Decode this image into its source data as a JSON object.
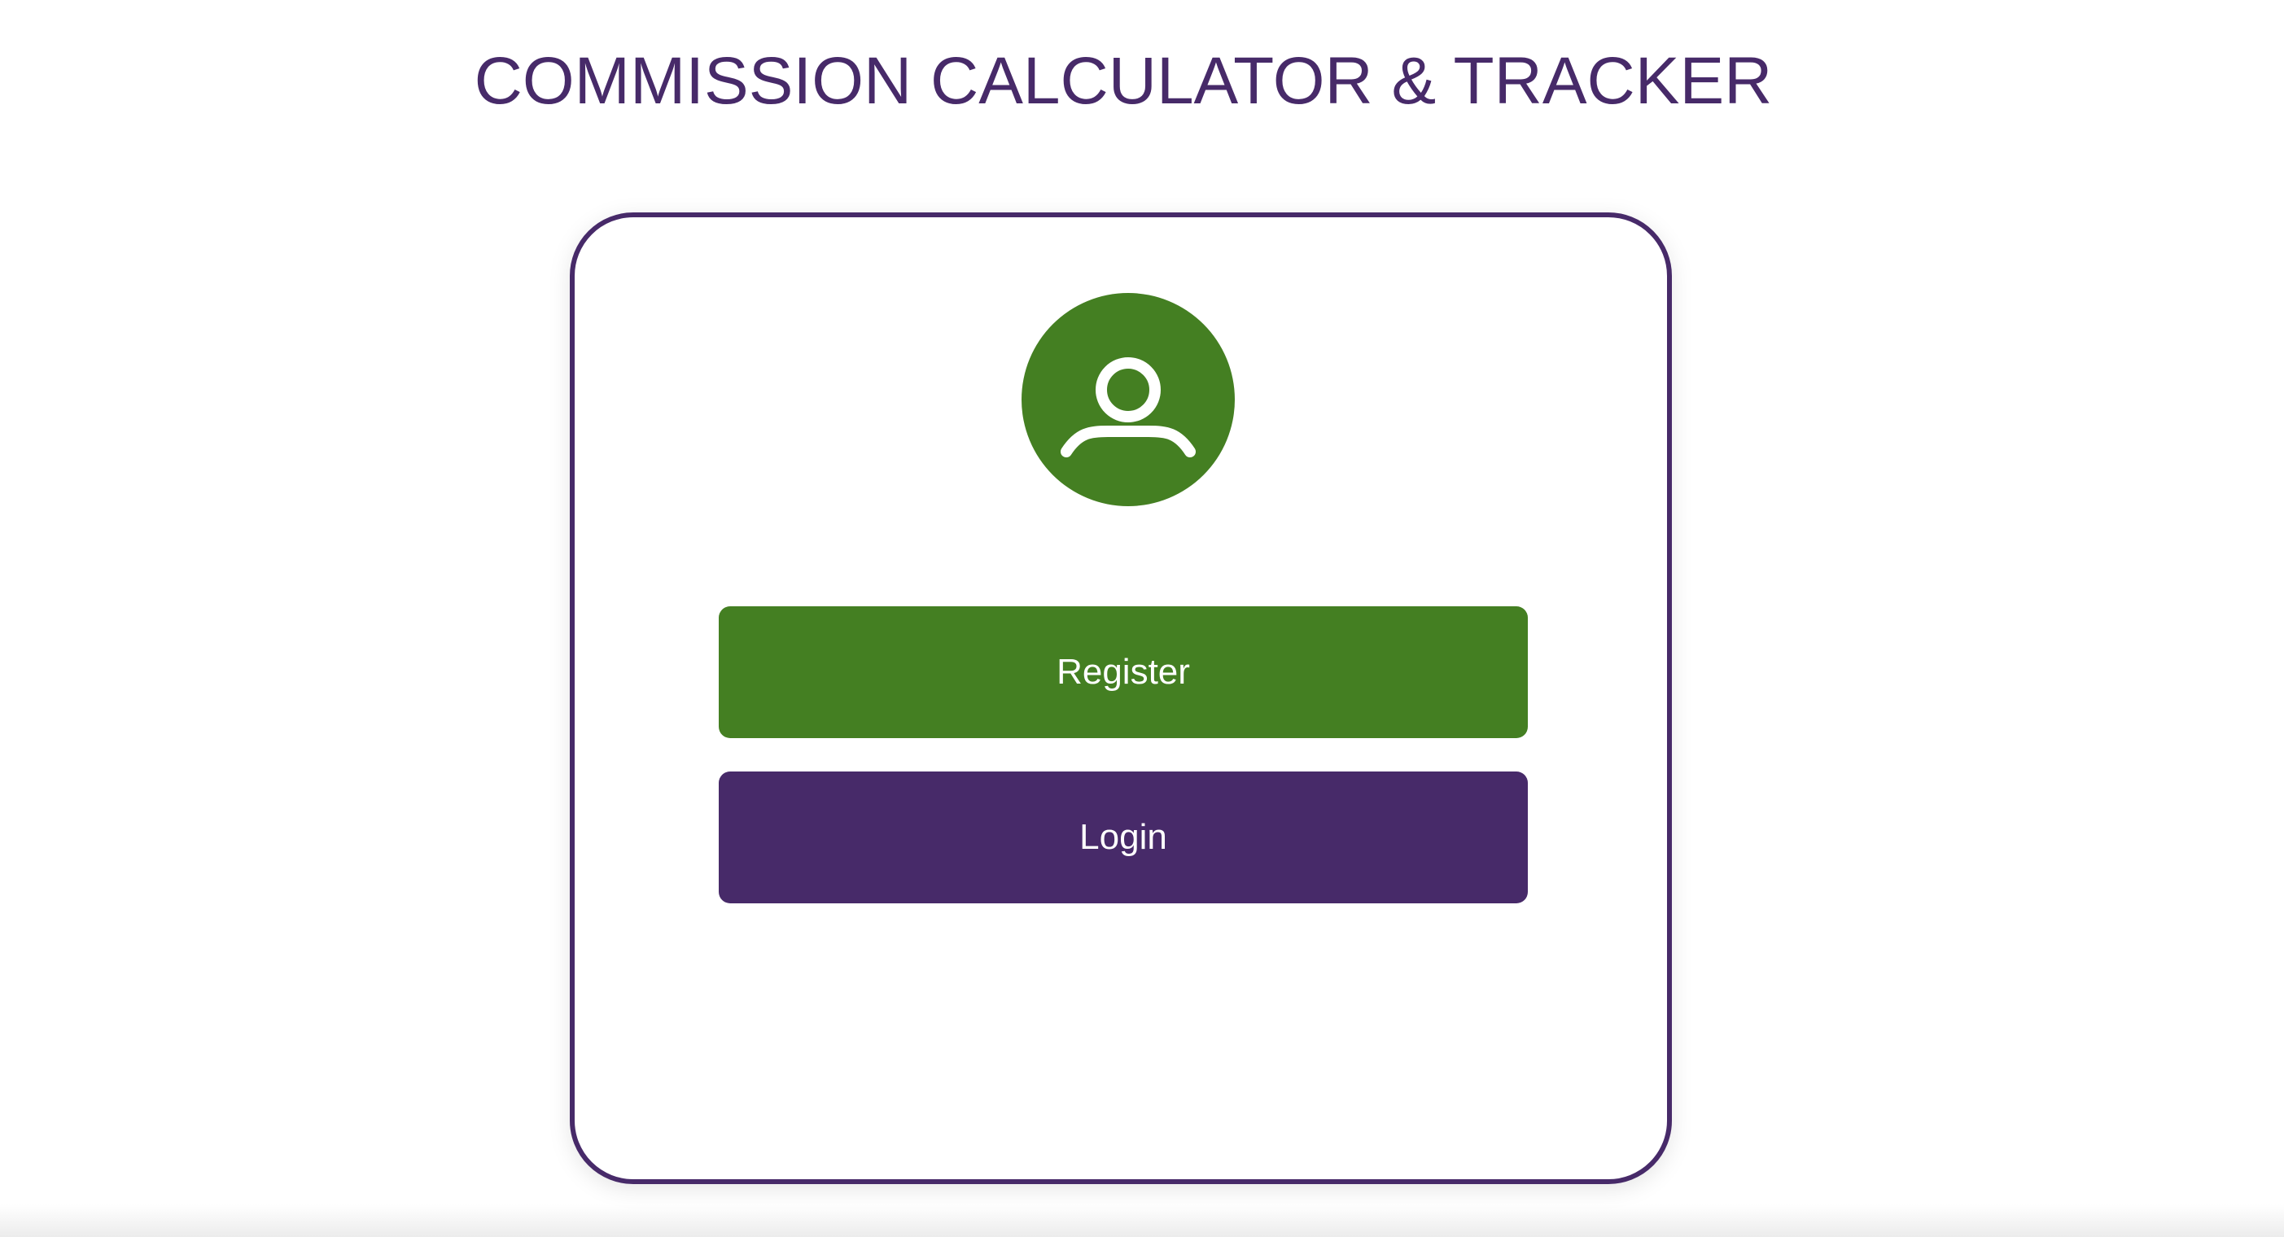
{
  "header": {
    "title": "COMMISSION CALCULATOR & TRACKER"
  },
  "card": {
    "avatar_icon": "user-icon",
    "register_label": "Register",
    "login_label": "Login"
  },
  "colors": {
    "brand_purple": "#472a69",
    "brand_green": "#447f22",
    "background": "#ffffff"
  }
}
